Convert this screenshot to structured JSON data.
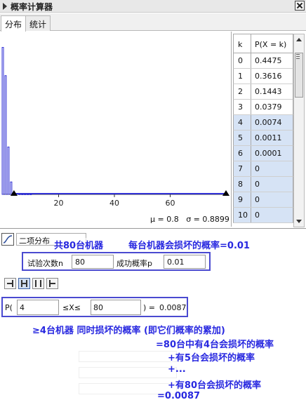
{
  "window": {
    "title": "概率计算器"
  },
  "tabs": [
    {
      "label": "分布"
    },
    {
      "label": "统计"
    }
  ],
  "chart_data": {
    "type": "bar",
    "x": [
      0,
      1,
      2,
      3,
      4,
      5,
      6,
      7,
      8,
      9,
      10
    ],
    "values": [
      0.4475,
      0.3616,
      0.1443,
      0.0379,
      0.0074,
      0.0011,
      0.0001,
      0,
      0,
      0,
      0
    ],
    "xlim": [
      0,
      80
    ],
    "ylim": [
      0,
      0.47
    ],
    "xticks": [
      20,
      40,
      60
    ],
    "color": "#3232d6",
    "highlight_from": 4,
    "grid": false
  },
  "stats": {
    "mu": "μ = 0.8",
    "sigma": "σ = 0.8899"
  },
  "table": {
    "headers": {
      "k": "k",
      "p": "P(X = k)"
    },
    "rows": [
      {
        "k": "0",
        "p": "0.4475",
        "selected": false
      },
      {
        "k": "1",
        "p": "0.3616",
        "selected": false
      },
      {
        "k": "2",
        "p": "0.1443",
        "selected": false
      },
      {
        "k": "3",
        "p": "0.0379",
        "selected": false
      },
      {
        "k": "4",
        "p": "0.0074",
        "selected": true
      },
      {
        "k": "5",
        "p": "0.0011",
        "selected": true
      },
      {
        "k": "6",
        "p": "0.0001",
        "selected": true
      },
      {
        "k": "7",
        "p": "0",
        "selected": true
      },
      {
        "k": "8",
        "p": "0",
        "selected": true
      },
      {
        "k": "9",
        "p": "0",
        "selected": true
      },
      {
        "k": "10",
        "p": "0",
        "selected": true
      }
    ]
  },
  "distribution": {
    "selected": "二项分布"
  },
  "params": {
    "n_label": "试验次数n",
    "n_value": "80",
    "p_label": "成功概率p",
    "p_value": "0.01"
  },
  "probability": {
    "prefix": "P(",
    "lower": "4",
    "relation": "≤X≤",
    "upper": "80",
    "suffix": ") =",
    "result": "0.0087"
  },
  "annotations": {
    "machines": "共80台机器",
    "per_machine": "每台机器会损坏的概率=0.01",
    "line1": "≥4台机器 同时损坏的概率 (即它们概率的累加)",
    "line2": "=80台中有4台会损坏的概率",
    "line3": "+有5台会损坏的概率",
    "line4": "+...",
    "line5": "+有80台会损坏的概率",
    "line6": "=0.0087"
  },
  "colors": {
    "annotation": "#2828e0",
    "frame": "#4a4ad0",
    "bars": "#3232d6",
    "selected_row": "#d6e3f5"
  },
  "icons": [
    "expand-triangle-icon",
    "close-icon",
    "distribution-curve-icon",
    "left-sided-icon",
    "interval-icon",
    "two-tailed-icon",
    "right-sided-icon"
  ]
}
